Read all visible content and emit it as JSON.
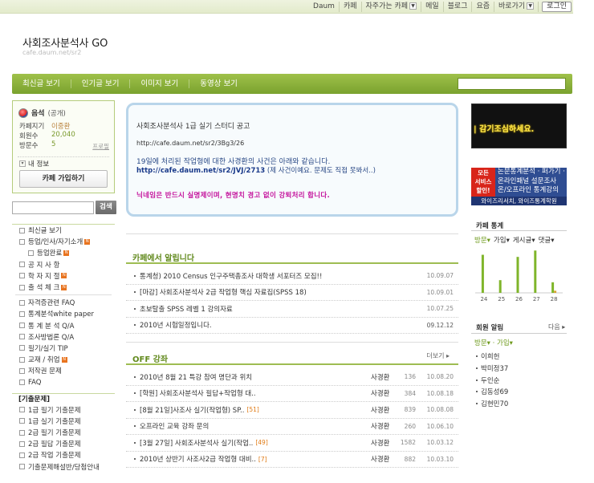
{
  "topbar": {
    "links": [
      "Daum",
      "카페",
      "자주가는 카페",
      "메일",
      "블로그",
      "요즘",
      "바로가기"
    ],
    "login": "로그인"
  },
  "header": {
    "title": "사회조사분석사 GO",
    "url": "cafe.daum.net/sr2"
  },
  "nav": {
    "tabs": [
      "최신글 보기",
      "인기글 보기",
      "이미지 보기",
      "동영상 보기"
    ]
  },
  "profile": {
    "name": "음석",
    "visibility": "(공개)",
    "rows": [
      {
        "k": "카페지기",
        "v": "이중환"
      },
      {
        "k": "회원수",
        "v": "20,040"
      },
      {
        "k": "방문수",
        "v": "5"
      }
    ],
    "profile_link": "프로필",
    "my_info": "내 정보",
    "join_button": "카페 가입하기"
  },
  "side_search": {
    "button": "검색"
  },
  "menu": {
    "group1": [
      {
        "label": "최신글 보기",
        "new": false,
        "sub": false
      },
      {
        "label": "등업/인사/자기소개",
        "new": true,
        "sub": false
      },
      {
        "label": "등업완료",
        "new": true,
        "sub": true
      },
      {
        "label": "공 지 사 항",
        "new": false,
        "sub": false
      },
      {
        "label": "학 자 지 절",
        "new": true,
        "sub": false
      },
      {
        "label": "출 석 체 크",
        "new": true,
        "sub": false
      }
    ],
    "group2": [
      {
        "label": "자격증관련 FAQ",
        "new": false
      },
      {
        "label": "통계분석white paper",
        "new": false
      },
      {
        "label": "통 계 분 석 Q/A",
        "new": false
      },
      {
        "label": "조사방법론 Q/A",
        "new": false
      },
      {
        "label": "필기/실기 TIP",
        "new": false
      },
      {
        "label": "교재 / 취업",
        "new": true
      },
      {
        "label": "저작권 문제",
        "new": false
      },
      {
        "label": "FAQ",
        "new": false
      }
    ],
    "category": "[기출문제]",
    "group3": [
      {
        "label": "1급 필기 기출문제"
      },
      {
        "label": "1급 실기 기출문제"
      },
      {
        "label": "2급 필기 기출문제"
      },
      {
        "label": "2급 필답 기출문제"
      },
      {
        "label": "2급 작업 기출문제"
      },
      {
        "label": "기출문제해설반/당첨안내"
      }
    ]
  },
  "notice": {
    "line1": "사회조사분석사 1급 실기 스터디 공고",
    "line2": "http://cafe.daum.net/sr2/3Bg3/26",
    "line3": "19일에 처리된 작업형에 대한 사경환의 사건은 아래와 같습니다.",
    "line4_link": "http://cafe.daum.net/sr2/JVJ/2713",
    "line4_note": " (제 사건이예요. 문제도 직접 못봐서..)",
    "line5": "닉네임은 반드시 실명제이며, 현명치 경고 없이 강퇴처리 합니다."
  },
  "cafe_notice": {
    "title": "카페에서 알립니다",
    "rows": [
      {
        "title": "통계청) 2010 Census 인구주택총조사 대학생 서포터즈 모집!!",
        "date": "10.09.07",
        "hl": false
      },
      {
        "title": "[마감] 사회조사분석사 2급 작업형 핵심 자료집(SPSS 18)",
        "date": "10.09.01",
        "hl": false
      },
      {
        "title": "초보탈출 SPSS 레벨 1 강의자료",
        "date": "10.07.25",
        "hl": false
      },
      {
        "title": "2010년 시험일정입니다.",
        "date": "09.12.12",
        "hl": true
      }
    ]
  },
  "off": {
    "title": "OFF 강좌",
    "more": "더보기",
    "rows": [
      {
        "title": "2010년 8월 21 특강 참여 명단과 위치",
        "cnt": "",
        "author": "사경환",
        "views": "136",
        "date": "10.08.20",
        "new": false
      },
      {
        "title": "[학원] 사회조사분석사 필답+작업형 대..",
        "cnt": "",
        "author": "사경환",
        "views": "384",
        "date": "10.08.18",
        "new": false
      },
      {
        "title": "[8월 21일]사조사 실기(작업형) SP..",
        "cnt": "[51]",
        "author": "사경환",
        "views": "839",
        "date": "10.08.08",
        "new": false
      },
      {
        "title": "오프라인 교육 강좌 문의",
        "cnt": "",
        "author": "사경환",
        "views": "260",
        "date": "10.06.10",
        "new": false
      },
      {
        "title": "[3월 27일] 사회조사분석사 실기(작업..",
        "cnt": "[49]",
        "author": "사경환",
        "views": "1582",
        "date": "10.03.12",
        "new": false
      },
      {
        "title": "2010년 상반기 사조사2급 작업형 대비..",
        "cnt": "[7]",
        "author": "사경환",
        "views": "882",
        "date": "10.03.10",
        "new": false
      }
    ]
  },
  "banner1": {
    "text": "| 감기조심하세요."
  },
  "banner2": {
    "left": "모든\n서비스\n할인!",
    "right1": "논문통계분석 · 퍼가기 ·",
    "right2": "온라인패널 설문조사",
    "right3": "온/오프라인 통계강의",
    "bottom": "와이즈리서치, 와이즈통계학원"
  },
  "stats": {
    "title": "카페 통계",
    "tabs": [
      "방문",
      "가입",
      "게시글",
      "댓글"
    ]
  },
  "chart_data": {
    "type": "bar",
    "categories": [
      "24",
      "25",
      "26",
      "27",
      "28"
    ],
    "series": [
      {
        "values": [
          18,
          6,
          17,
          20,
          5
        ]
      },
      {
        "values": [
          0,
          0,
          0,
          0,
          1
        ]
      }
    ],
    "ylim": [
      0,
      22
    ],
    "colors": [
      "#7fb52a",
      "#d7a230"
    ]
  },
  "members": {
    "title": "회원 알림",
    "next": "다음",
    "tab": "방문",
    "tab2": "가입",
    "list": [
      "이희헌",
      "박미정37",
      "두인순",
      "김동성69",
      "김현민70"
    ]
  }
}
